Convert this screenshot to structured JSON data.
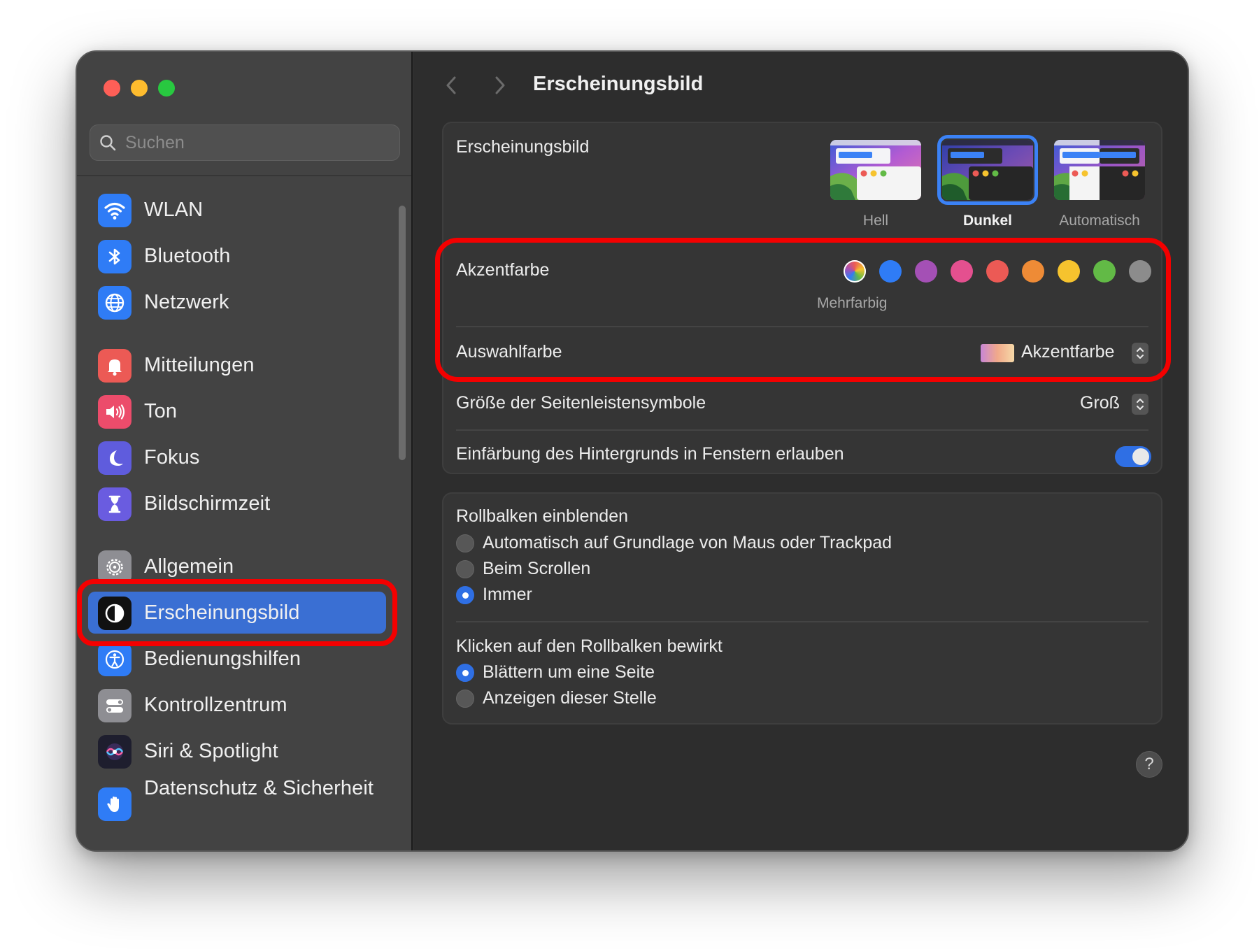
{
  "window": {
    "title": "Erscheinungsbild"
  },
  "search": {
    "placeholder": "Suchen"
  },
  "sidebar": {
    "items": [
      {
        "label": "WLAN",
        "icon": "wifi-icon"
      },
      {
        "label": "Bluetooth",
        "icon": "bluetooth-icon"
      },
      {
        "label": "Netzwerk",
        "icon": "globe-icon"
      },
      {
        "label": "Mitteilungen",
        "icon": "bell-icon"
      },
      {
        "label": "Ton",
        "icon": "speaker-icon"
      },
      {
        "label": "Fokus",
        "icon": "moon-icon"
      },
      {
        "label": "Bildschirmzeit",
        "icon": "hourglass-icon"
      },
      {
        "label": "Allgemein",
        "icon": "gear-icon"
      },
      {
        "label": "Erscheinungsbild",
        "icon": "appearance-icon",
        "selected": true
      },
      {
        "label": "Bedienungshilfen",
        "icon": "accessibility-icon"
      },
      {
        "label": "Kontrollzentrum",
        "icon": "control-center-icon"
      },
      {
        "label": "Siri & Spotlight",
        "icon": "siri-icon"
      },
      {
        "label": "Datenschutz & Sicherheit",
        "icon": "hand-icon"
      }
    ]
  },
  "appearance": {
    "label": "Erscheinungsbild",
    "options": [
      {
        "label": "Hell",
        "selected": false
      },
      {
        "label": "Dunkel",
        "selected": true
      },
      {
        "label": "Automatisch",
        "selected": false
      }
    ]
  },
  "accent": {
    "label": "Akzentfarbe",
    "selected_name": "Mehrfarbig",
    "colors": [
      "multicolor",
      "#2f7cf6",
      "#a450b5",
      "#e4508f",
      "#ec5a55",
      "#ee8b36",
      "#f6c32e",
      "#62ba46",
      "#8c8c8c"
    ]
  },
  "highlight": {
    "label": "Auswahlfarbe",
    "value": "Akzentfarbe"
  },
  "sidebar_icon_size": {
    "label": "Größe der Seitenleistensymbole",
    "value": "Groß"
  },
  "wallpaper_tinting": {
    "label": "Einfärbung des Hintergrunds in Fenstern erlauben",
    "enabled": true
  },
  "show_scrollbars": {
    "label": "Rollbalken einblenden",
    "options": [
      {
        "label": "Automatisch auf Grundlage von Maus oder Trackpad",
        "selected": false
      },
      {
        "label": "Beim Scrollen",
        "selected": false
      },
      {
        "label": "Immer",
        "selected": true
      }
    ]
  },
  "click_scrollbar": {
    "label": "Klicken auf den Rollbalken bewirkt",
    "options": [
      {
        "label": "Blättern um eine Seite",
        "selected": true
      },
      {
        "label": "Anzeigen dieser Stelle",
        "selected": false
      }
    ]
  },
  "help": {
    "label": "?"
  },
  "colors": {
    "accent_blue": "#2f6fe4",
    "annotation_red": "#f40000",
    "sidebar_bg": "#434343",
    "main_bg": "#2d2d2d"
  }
}
